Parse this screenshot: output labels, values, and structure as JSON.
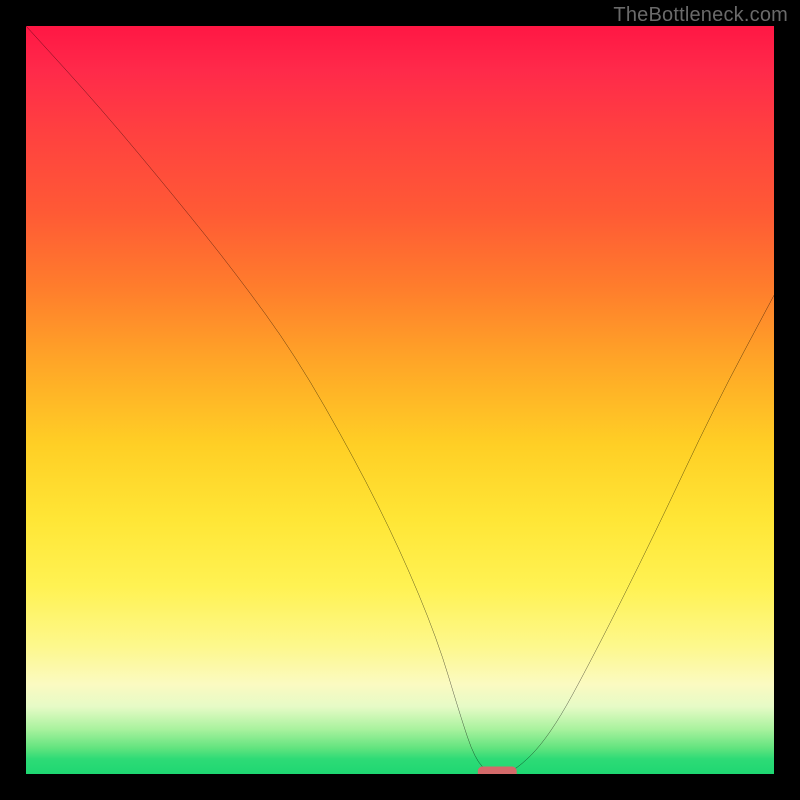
{
  "watermark": "TheBottleneck.com",
  "chart_data": {
    "type": "line",
    "title": "",
    "xlabel": "",
    "ylabel": "",
    "xlim": [
      0,
      100
    ],
    "ylim": [
      0,
      100
    ],
    "grid": false,
    "legend": false,
    "series": [
      {
        "name": "bottleneck-curve",
        "x": [
          0,
          10,
          20,
          28,
          36,
          44,
          50,
          55,
          58,
          60,
          62,
          65,
          70,
          76,
          84,
          92,
          100
        ],
        "y": [
          100,
          89,
          77,
          67,
          56,
          42,
          30,
          18,
          8,
          2,
          0,
          0,
          5,
          16,
          32,
          49,
          64
        ]
      }
    ],
    "marker": {
      "name": "optimal-point",
      "x": 63,
      "y": 0,
      "color": "#d46a6a",
      "shape": "rounded-bar"
    },
    "background_gradient": {
      "top": "#ff1744",
      "mid": "#ffe636",
      "bottom": "#1ed772"
    }
  }
}
